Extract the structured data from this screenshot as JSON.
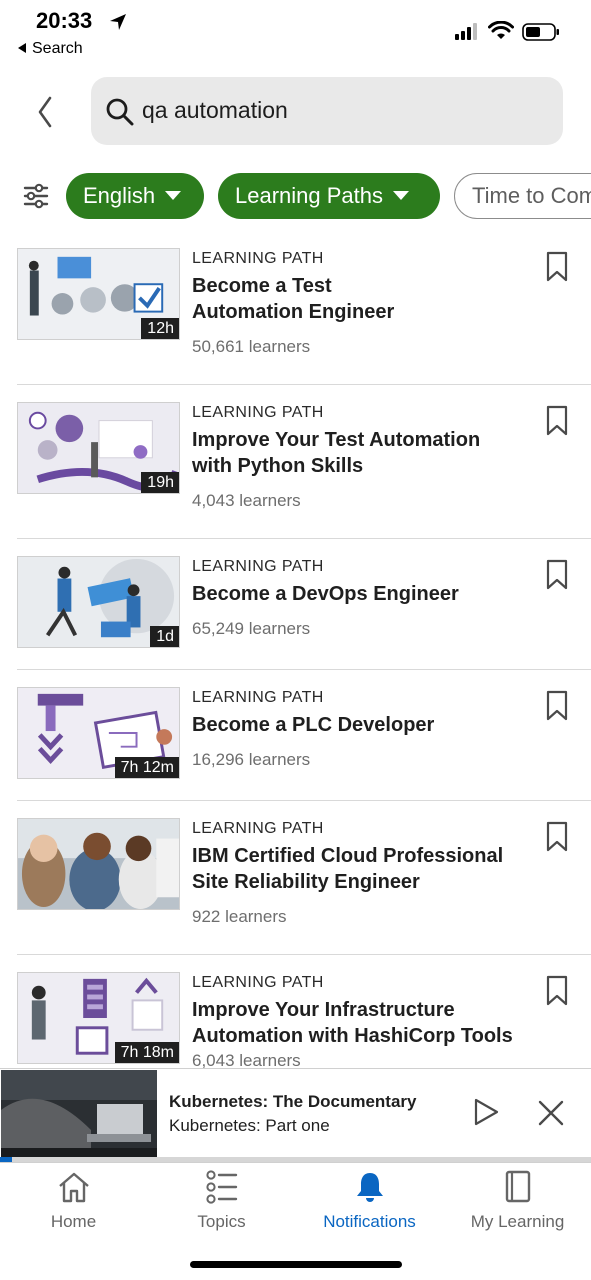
{
  "status_bar": {
    "time": "20:33",
    "back_app": "Search"
  },
  "search": {
    "query": "qa automation"
  },
  "filters": {
    "chips": [
      {
        "label": "English",
        "active": true
      },
      {
        "label": "Learning Paths",
        "active": true
      },
      {
        "label": "Time to Complete",
        "active": false
      }
    ]
  },
  "results": [
    {
      "kind": "LEARNING PATH",
      "title_line1": "Become a Test",
      "title_line2": "Automation Engineer",
      "learners": "50,661 learners",
      "duration": "12h"
    },
    {
      "kind": "LEARNING PATH",
      "title_line1": "Improve Your Test Automation",
      "title_line2": "with Python Skills",
      "learners": "4,043 learners",
      "duration": "19h"
    },
    {
      "kind": "LEARNING PATH",
      "title_line1": "Become a DevOps Engineer",
      "title_line2": "",
      "learners": "65,249 learners",
      "duration": "1d"
    },
    {
      "kind": "LEARNING PATH",
      "title_line1": "Become a PLC Developer",
      "title_line2": "",
      "learners": "16,296 learners",
      "duration": "7h 12m"
    },
    {
      "kind": "LEARNING PATH",
      "title_line1": "IBM Certified Cloud Professional",
      "title_line2": "Site Reliability Engineer",
      "learners": "922 learners",
      "duration": ""
    },
    {
      "kind": "LEARNING PATH",
      "title_line1": "Improve Your Infrastructure",
      "title_line2": "Automation with HashiCorp Tools",
      "learners": "6,043 learners",
      "duration": "7h 18m"
    }
  ],
  "mini_player": {
    "title": "Kubernetes: The Documentary",
    "subtitle": "Kubernetes: Part one",
    "progress": 0.02
  },
  "tabs": [
    {
      "label": "Home",
      "icon": "home-icon",
      "active": false
    },
    {
      "label": "Topics",
      "icon": "topics-list-icon",
      "active": false
    },
    {
      "label": "Notifications",
      "icon": "bell-icon",
      "active": true
    },
    {
      "label": "My Learning",
      "icon": "book-icon",
      "active": false
    }
  ],
  "colors": {
    "chip_active": "#2c7c1d",
    "accent_blue": "#0a66c2",
    "search_bg": "#e9e9e9"
  }
}
